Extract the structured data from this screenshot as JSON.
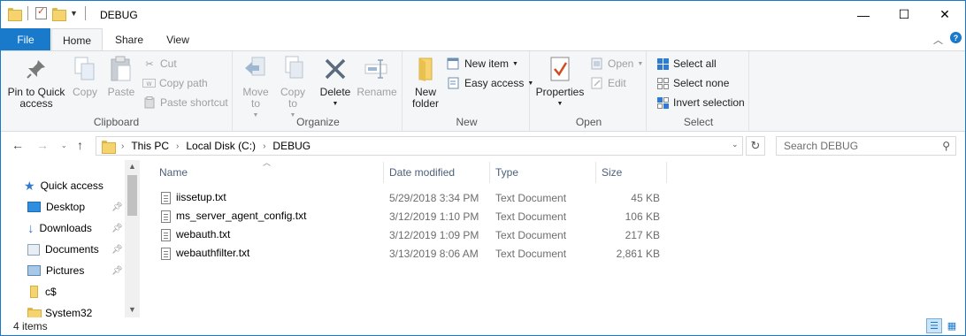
{
  "window": {
    "title": "DEBUG",
    "minimize_glyph": "—",
    "maximize_glyph": "☐",
    "close_glyph": "✕"
  },
  "ribbon_tabs": [
    {
      "label": "File"
    },
    {
      "label": "Home"
    },
    {
      "label": "Share"
    },
    {
      "label": "View"
    }
  ],
  "ribbon": {
    "clipboard": {
      "label": "Clipboard",
      "pin_to_quick_access": "Pin to Quick access",
      "copy": "Copy",
      "paste": "Paste",
      "cut": "Cut",
      "copy_path": "Copy path",
      "paste_shortcut": "Paste shortcut"
    },
    "organize": {
      "label": "Organize",
      "move_to": "Move to",
      "copy_to": "Copy to",
      "delete": "Delete",
      "rename": "Rename"
    },
    "new": {
      "label": "New",
      "new_folder": "New folder",
      "new_item": "New item",
      "easy_access": "Easy access"
    },
    "open": {
      "label": "Open",
      "properties": "Properties",
      "open": "Open",
      "edit": "Edit"
    },
    "select": {
      "label": "Select",
      "select_all": "Select all",
      "select_none": "Select none",
      "invert_selection": "Invert selection"
    }
  },
  "address": {
    "crumbs": [
      "This PC",
      "Local Disk (C:)",
      "DEBUG"
    ],
    "search_placeholder": "Search DEBUG"
  },
  "nav_pane": {
    "items": [
      {
        "label": "Quick access",
        "icon": "star-icon",
        "pinned": false
      },
      {
        "label": "Desktop",
        "icon": "desktop-icon",
        "pinned": true
      },
      {
        "label": "Downloads",
        "icon": "download-icon",
        "pinned": true
      },
      {
        "label": "Documents",
        "icon": "documents-icon",
        "pinned": true
      },
      {
        "label": "Pictures",
        "icon": "pictures-icon",
        "pinned": true
      },
      {
        "label": "c$",
        "icon": "network-drive-icon",
        "pinned": false
      },
      {
        "label": "System32",
        "icon": "folder-icon",
        "pinned": false
      }
    ]
  },
  "file_list": {
    "columns": [
      "Name",
      "Date modified",
      "Type",
      "Size"
    ],
    "rows": [
      {
        "name": "iissetup.txt",
        "date": "5/29/2018 3:34 PM",
        "type": "Text Document",
        "size": "45 KB"
      },
      {
        "name": "ms_server_agent_config.txt",
        "date": "3/12/2019 1:10 PM",
        "type": "Text Document",
        "size": "106 KB"
      },
      {
        "name": "webauth.txt",
        "date": "3/12/2019 1:09 PM",
        "type": "Text Document",
        "size": "217 KB"
      },
      {
        "name": "webauthfilter.txt",
        "date": "3/13/2019 8:06 AM",
        "type": "Text Document",
        "size": "2,861 KB"
      }
    ]
  },
  "status": {
    "item_count": "4 items"
  },
  "colors": {
    "accent": "#1979ca",
    "ribbon_bg": "#f5f6f7",
    "header_text": "#4c607a"
  }
}
